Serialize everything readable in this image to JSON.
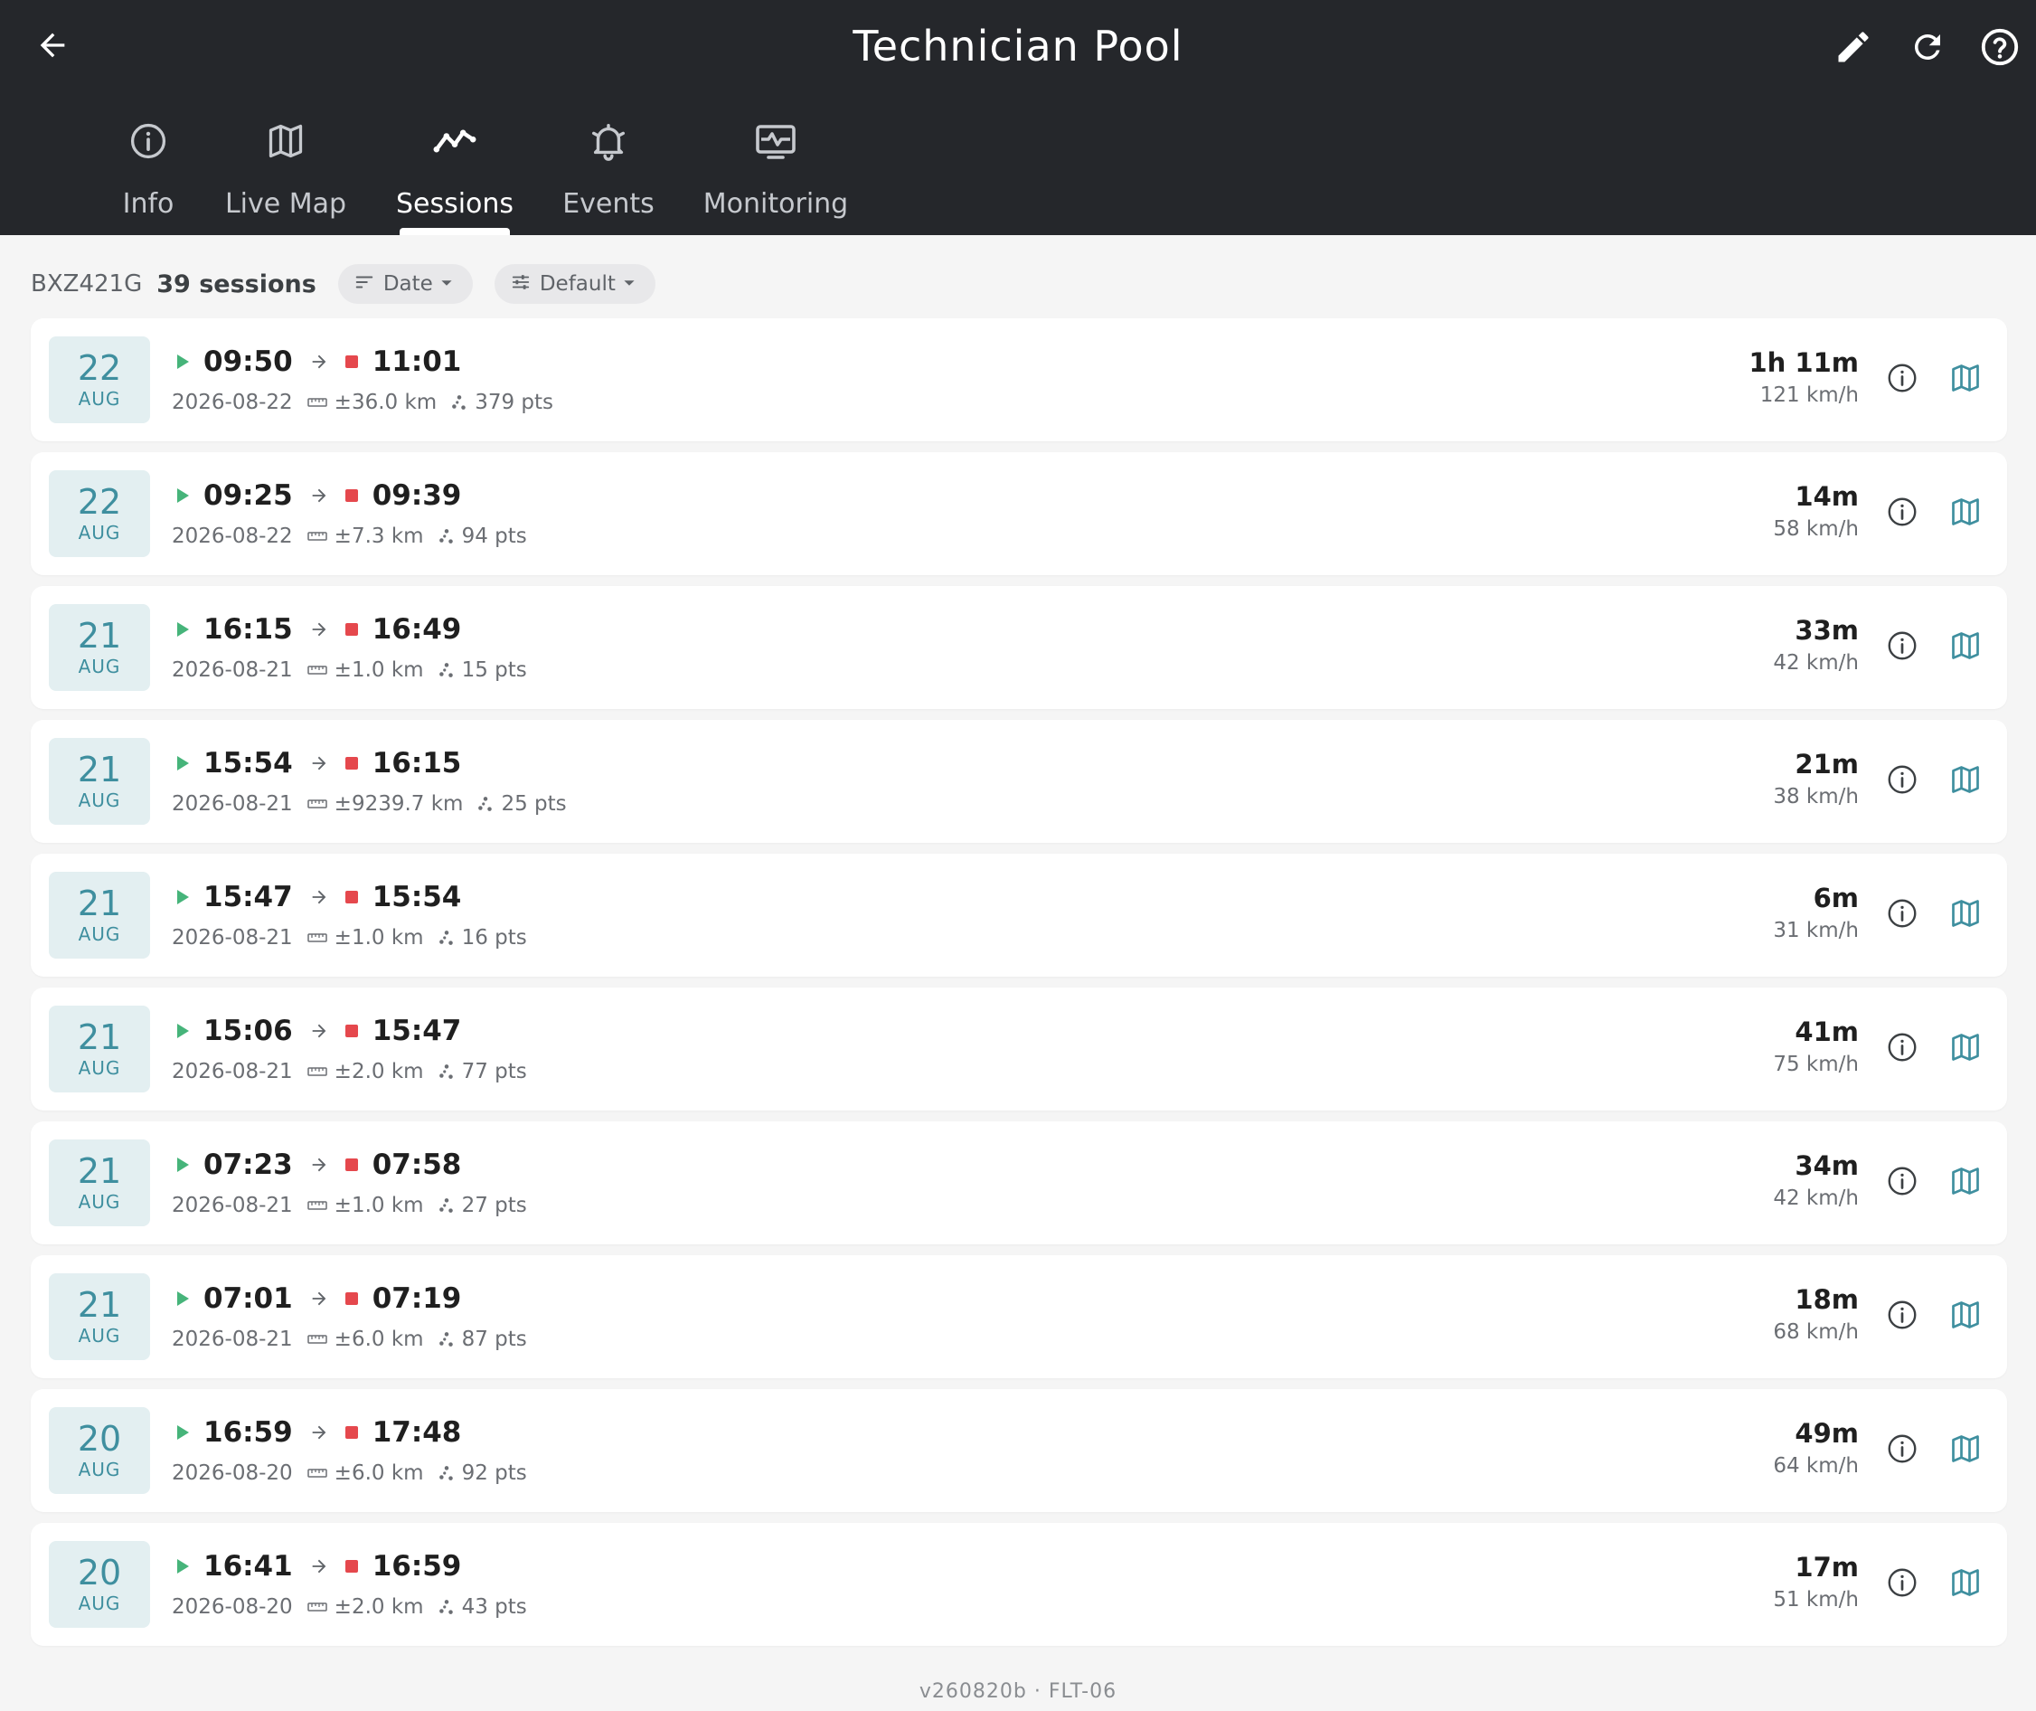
{
  "header": {
    "title": "Technician Pool",
    "back_icon": "arrow-left-icon",
    "actions": [
      {
        "name": "edit",
        "icon": "pencil-icon"
      },
      {
        "name": "refresh",
        "icon": "refresh-icon"
      },
      {
        "name": "help",
        "icon": "help-circle-icon"
      }
    ]
  },
  "tabs": [
    {
      "label": "Info",
      "icon": "info-circle-icon",
      "active": false
    },
    {
      "label": "Live Map",
      "icon": "map-icon",
      "active": false
    },
    {
      "label": "Sessions",
      "icon": "trend-line-icon",
      "active": true
    },
    {
      "label": "Events",
      "icon": "bell-icon",
      "active": false
    },
    {
      "label": "Monitoring",
      "icon": "monitor-pulse-icon",
      "active": false
    }
  ],
  "subheader": {
    "plate": "BXZ421G",
    "count": "39 sessions",
    "sort_label": "Date",
    "filter_label": "Default"
  },
  "sessions": [
    {
      "day": "22",
      "month": "AUG",
      "start": "09:50",
      "end": "11:01",
      "date": "2026-08-22",
      "distance": "±36.0 km",
      "points": "379 pts",
      "duration": "1h 11m",
      "speed": "121 km/h"
    },
    {
      "day": "22",
      "month": "AUG",
      "start": "09:25",
      "end": "09:39",
      "date": "2026-08-22",
      "distance": "±7.3 km",
      "points": "94 pts",
      "duration": "14m",
      "speed": "58 km/h"
    },
    {
      "day": "21",
      "month": "AUG",
      "start": "16:15",
      "end": "16:49",
      "date": "2026-08-21",
      "distance": "±1.0 km",
      "points": "15 pts",
      "duration": "33m",
      "speed": "42 km/h"
    },
    {
      "day": "21",
      "month": "AUG",
      "start": "15:54",
      "end": "16:15",
      "date": "2026-08-21",
      "distance": "±9239.7 km",
      "points": "25 pts",
      "duration": "21m",
      "speed": "38 km/h"
    },
    {
      "day": "21",
      "month": "AUG",
      "start": "15:47",
      "end": "15:54",
      "date": "2026-08-21",
      "distance": "±1.0 km",
      "points": "16 pts",
      "duration": "6m",
      "speed": "31 km/h"
    },
    {
      "day": "21",
      "month": "AUG",
      "start": "15:06",
      "end": "15:47",
      "date": "2026-08-21",
      "distance": "±2.0 km",
      "points": "77 pts",
      "duration": "41m",
      "speed": "75 km/h"
    },
    {
      "day": "21",
      "month": "AUG",
      "start": "07:23",
      "end": "07:58",
      "date": "2026-08-21",
      "distance": "±1.0 km",
      "points": "27 pts",
      "duration": "34m",
      "speed": "42 km/h"
    },
    {
      "day": "21",
      "month": "AUG",
      "start": "07:01",
      "end": "07:19",
      "date": "2026-08-21",
      "distance": "±6.0 km",
      "points": "87 pts",
      "duration": "18m",
      "speed": "68 km/h"
    },
    {
      "day": "20",
      "month": "AUG",
      "start": "16:59",
      "end": "17:48",
      "date": "2026-08-20",
      "distance": "±6.0 km",
      "points": "92 pts",
      "duration": "49m",
      "speed": "64 km/h"
    },
    {
      "day": "20",
      "month": "AUG",
      "start": "16:41",
      "end": "16:59",
      "date": "2026-08-20",
      "distance": "±2.0 km",
      "points": "43 pts",
      "duration": "17m",
      "speed": "51 km/h"
    }
  ],
  "footer": {
    "version": "v260820b · FLT-06"
  },
  "colors": {
    "header_bg": "#25272b",
    "accent": "#3f8f9f",
    "start_green": "#46b47a",
    "stop_red": "#e5484d",
    "page_bg": "#f5f5f5"
  }
}
